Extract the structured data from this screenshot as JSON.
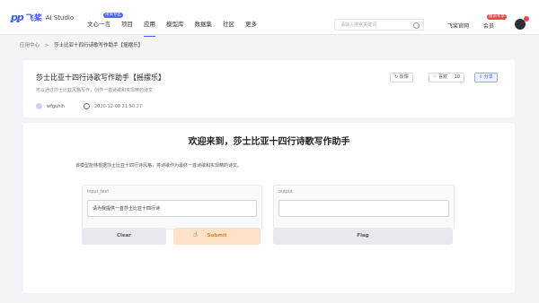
{
  "brand": {
    "mark": "ꝑꝑ",
    "name": "飞桨",
    "sub": "AI Studio"
  },
  "nav": [
    {
      "label": "文心一言",
      "badge": "项目专区"
    },
    {
      "label": "项目"
    },
    {
      "label": "应用",
      "active": true
    },
    {
      "label": "模型库"
    },
    {
      "label": "数据集"
    },
    {
      "label": "社区"
    },
    {
      "label": "更多"
    }
  ],
  "search": {
    "placeholder": "请输入搜索关键词"
  },
  "right": {
    "link1": "飞桨官网",
    "link2": "会员",
    "link2_badge": "会员专享"
  },
  "breadcrumb": {
    "root": "应用中心",
    "sep": ">",
    "current": "莎士比亚十四行诗歌写作助手【摇摆乐】"
  },
  "app": {
    "title": "莎士比亚十四行诗歌写作助手【摇摆乐】",
    "desc": "可以通过莎士比亚风格写作，创作一首诗歌和实现精的诗文",
    "author": "wfguhih",
    "time": "2020-12-08 21:50:27",
    "actions": {
      "feedback": "反馈",
      "like": "喜欢",
      "like_count": "10",
      "share": "分享"
    }
  },
  "main": {
    "title": "欢迎来到，莎士比亚十四行诗歌写作助手",
    "desc": "该模型能够根据莎士比亚十四行诗风格，将诗歌作为最终一首诗歌和实现精的诗文。",
    "input_label": "input_text",
    "input_value": "请为我提供一首莎士比亚十四行诗",
    "output_label": "output",
    "buttons": {
      "clear": "Clear",
      "submit": "Submit",
      "flag": "Flag"
    }
  }
}
